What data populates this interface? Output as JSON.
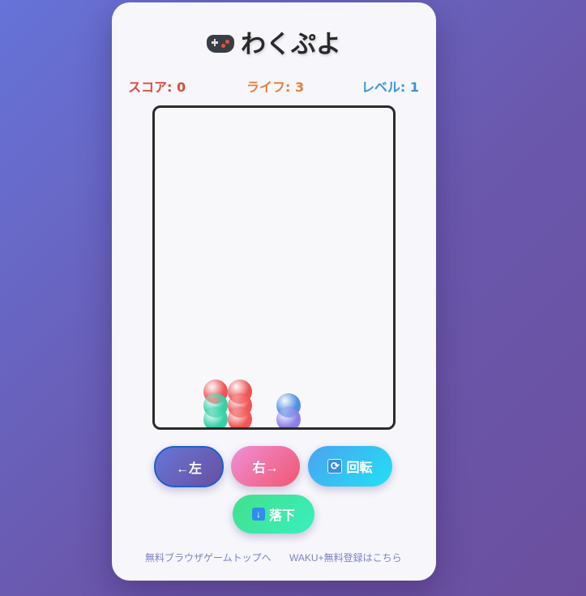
{
  "game": {
    "title": "わくぷよ",
    "icon": "gamepad-icon"
  },
  "stats": {
    "score": "スコア: 0",
    "life": "ライフ: 3",
    "level": "レベル: 1"
  },
  "colors": {
    "red": "#f05454",
    "green": "#33d0a4",
    "blue": "#4b90e4",
    "purple": "#8b7ee8"
  },
  "board": {
    "columns": 6,
    "visible_rows": 13,
    "puyos": [
      {
        "col": 1,
        "row_from_bottom": 1,
        "color": "green"
      },
      {
        "col": 1,
        "row_from_bottom": 2,
        "color": "green"
      },
      {
        "col": 1,
        "row_from_bottom": 3,
        "color": "red"
      },
      {
        "col": 2,
        "row_from_bottom": 1,
        "color": "red"
      },
      {
        "col": 2,
        "row_from_bottom": 2,
        "color": "red"
      },
      {
        "col": 2,
        "row_from_bottom": 3,
        "color": "red"
      },
      {
        "col": 4,
        "row_from_bottom": 1,
        "color": "purple"
      },
      {
        "col": 4,
        "row_from_bottom": 2,
        "color": "blue"
      }
    ]
  },
  "controls": {
    "left": "←左",
    "right": "右→",
    "rotate": "回転",
    "rotate_icon": "rotate-icon",
    "drop": "落下",
    "drop_icon": "down-arrow-icon"
  },
  "footer": {
    "link1": "無料ブラウザゲームトップへ",
    "link2": "WAKU+無料登録はこちら"
  }
}
